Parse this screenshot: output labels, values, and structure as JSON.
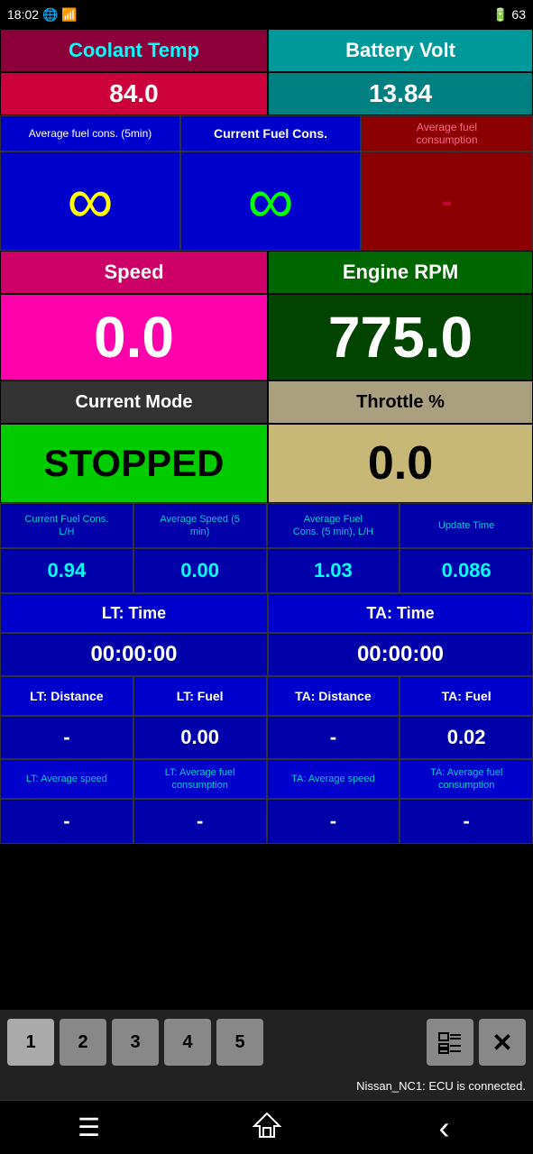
{
  "status_bar": {
    "time": "18:02",
    "icons_left": "wifi signal",
    "battery": "63"
  },
  "coolant": {
    "label": "Coolant Temp",
    "value": "84.0"
  },
  "battery": {
    "label": "Battery Volt",
    "value": "13.84"
  },
  "fuel": {
    "avg_label": "Average fuel cons. (5min)",
    "curr_label": "Current Fuel Cons.",
    "avg2_label": "Average fuel\nconsumption",
    "avg_value": "∞",
    "curr_value": "∞",
    "avg2_value": "-"
  },
  "speed": {
    "label": "Speed",
    "value": "0.0"
  },
  "rpm": {
    "label": "Engine RPM",
    "value": "775.0"
  },
  "mode": {
    "label": "Current Mode",
    "value": "STOPPED"
  },
  "throttle": {
    "label": "Throttle %",
    "value": "0.0"
  },
  "stats": {
    "labels": [
      "Current Fuel Cons.\nL/H",
      "Average Speed (5 min)",
      "Average Fuel\nCons. (5 min), L/H",
      "Update Time"
    ],
    "values": [
      "0.94",
      "0.00",
      "1.03",
      "0.086"
    ]
  },
  "lt_time": {
    "label": "LT: Time",
    "value": "00:00:00"
  },
  "ta_time": {
    "label": "TA: Time",
    "value": "00:00:00"
  },
  "dist_fuel": {
    "labels": [
      "LT: Distance",
      "LT: Fuel",
      "TA: Distance",
      "TA: Fuel"
    ],
    "values": [
      "-",
      "0.00",
      "-",
      "0.02"
    ]
  },
  "avg_bottom": {
    "labels": [
      "LT: Average speed",
      "LT: Average fuel\nconsumption",
      "TA: Average speed",
      "TA: Average fuel\nconsumption"
    ],
    "values": [
      "-",
      "-",
      "-",
      "-"
    ]
  },
  "pages": {
    "buttons": [
      "1",
      "2",
      "3",
      "4",
      "5"
    ],
    "active": "1"
  },
  "status_message": "Nissan_NC1: ECU is connected.",
  "nav": {
    "menu": "☰",
    "home": "⌂",
    "back": "‹"
  }
}
